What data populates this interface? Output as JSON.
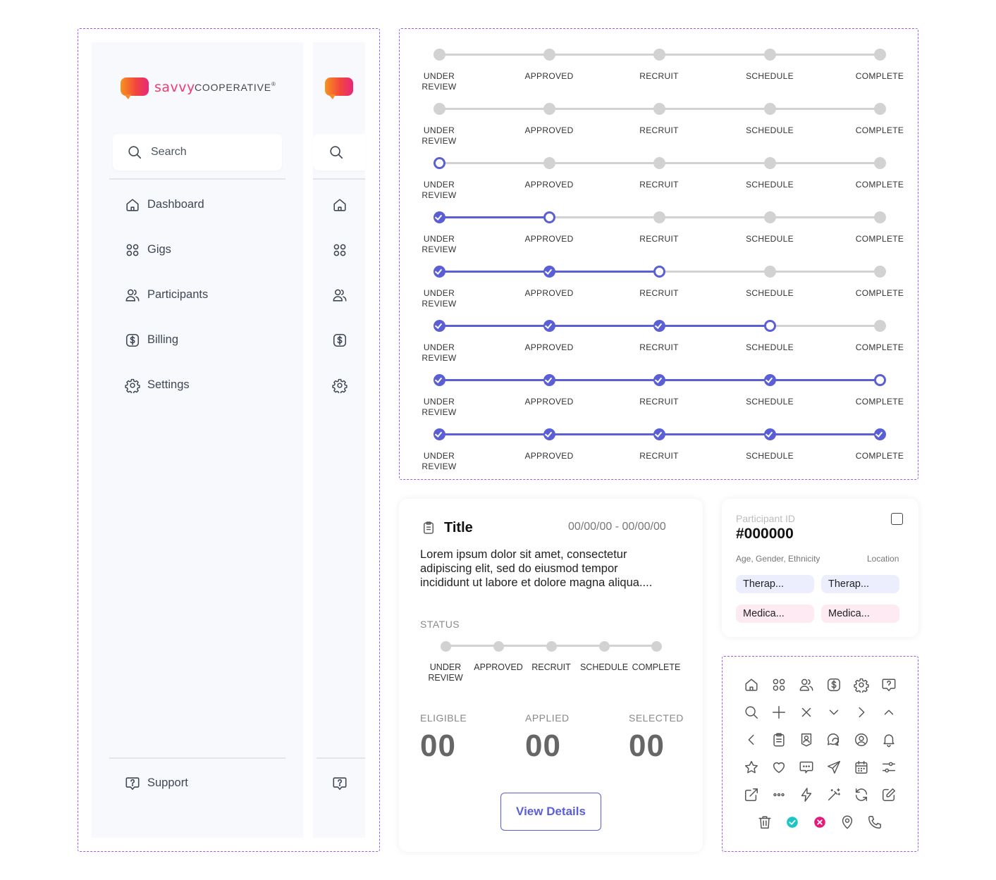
{
  "sidebar": {
    "logo": {
      "word1": "savvy",
      "word2": "COOPERATIVE",
      "mark": "®"
    },
    "search_placeholder": "Search",
    "items": [
      {
        "label": "Dashboard",
        "icon": "home-icon"
      },
      {
        "label": "Gigs",
        "icon": "grid-icon"
      },
      {
        "label": "Participants",
        "icon": "users-icon"
      },
      {
        "label": "Billing",
        "icon": "dollar-icon"
      },
      {
        "label": "Settings",
        "icon": "gear-icon"
      }
    ],
    "support_label": "Support"
  },
  "stepper": {
    "steps": [
      "UNDER\nREVIEW",
      "APPROVED",
      "RECRUIT",
      "SCHEDULE",
      "COMPLETE"
    ],
    "rows": [
      {
        "completed": 0,
        "current": null
      },
      {
        "completed": 0,
        "current": null
      },
      {
        "completed": 0,
        "current": 0
      },
      {
        "completed": 1,
        "current": 1
      },
      {
        "completed": 2,
        "current": 2
      },
      {
        "completed": 3,
        "current": 3
      },
      {
        "completed": 4,
        "current": 4
      },
      {
        "completed": 5,
        "current": null
      }
    ],
    "colors": {
      "active": "#5a5fd6",
      "inactive": "#d2d2d2"
    }
  },
  "gig_card": {
    "title": "Title",
    "date_range": "00/00/00 - 00/00/00",
    "description_lines": [
      "Lorem ipsum dolor sit amet, consectetur",
      "adipiscing elit, sed do eiusmod tempor",
      "incididunt ut labore et dolore magna aliqua...."
    ],
    "status_label": "STATUS",
    "status_steps": [
      "UNDER\nREVIEW",
      "APPROVED",
      "RECRUIT",
      "SCHEDULE",
      "COMPLETE"
    ],
    "stats": [
      {
        "label": "ELIGIBLE",
        "value": "00"
      },
      {
        "label": "APPLIED",
        "value": "00"
      },
      {
        "label": "SELECTED",
        "value": "00"
      }
    ],
    "button_label": "View Details"
  },
  "participant_card": {
    "id_label": "Participant ID",
    "id_value": "#000000",
    "demographics": "Age, Gender, Ethnicity",
    "location": "Location",
    "chips": [
      {
        "text": "Therap...",
        "color": "purple"
      },
      {
        "text": "Therap...",
        "color": "purple"
      },
      {
        "text": "Medica...",
        "color": "pink"
      },
      {
        "text": "Medica...",
        "color": "pink"
      }
    ]
  },
  "icon_grid": [
    [
      "home-icon",
      "grid-icon",
      "users-icon",
      "dollar-icon",
      "gear-icon",
      "help-bubble-icon"
    ],
    [
      "search-icon",
      "plus-icon",
      "close-icon",
      "chevron-down-icon",
      "chevron-right-icon",
      "chevron-up-icon"
    ],
    [
      "chevron-left-icon",
      "clipboard-icon",
      "user-badge-icon",
      "chat-bubbles-icon",
      "user-circle-icon",
      "bell-icon"
    ],
    [
      "star-icon",
      "heart-icon",
      "message-icon",
      "send-icon",
      "calendar-icon",
      "sliders-icon"
    ],
    [
      "external-link-icon",
      "more-icon",
      "lightning-icon",
      "magic-wand-icon",
      "refresh-icon",
      "edit-icon"
    ],
    [
      "trash-icon",
      "check-circle-icon",
      "x-circle-icon",
      "location-pin-icon",
      "phone-icon"
    ]
  ],
  "colors": {
    "accent": "#5a5fd6",
    "success": "#1bc5c5",
    "danger": "#e6197a",
    "frame": "#9b5de5"
  }
}
